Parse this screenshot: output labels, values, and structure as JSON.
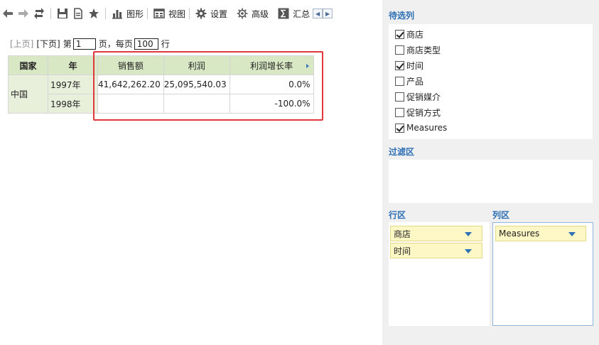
{
  "toolbar": {
    "buttons": [
      {
        "name": "back",
        "icon": "arrow-left-icon"
      },
      {
        "name": "forward",
        "icon": "arrow-right-icon"
      },
      {
        "name": "refresh",
        "icon": "refresh-icon"
      },
      {
        "name": "save",
        "icon": "save-icon"
      },
      {
        "name": "export",
        "icon": "document-icon"
      },
      {
        "name": "favorite",
        "icon": "star-icon"
      }
    ],
    "chart_label": "图形",
    "view_label": "视图",
    "settings_label": "设置",
    "advanced_label": "高级",
    "summary_label": "汇总"
  },
  "pager": {
    "prev": "[上页]",
    "next": "[下页]",
    "page_prefix": "第",
    "page_value": "1",
    "page_suffix": "页，每页",
    "rows_value": "100",
    "rows_suffix": "行"
  },
  "pivot": {
    "row_headers": [
      "国家",
      "年"
    ],
    "col_headers": [
      "销售额",
      "利润",
      "利润增长率"
    ],
    "country": "中国",
    "rows": [
      {
        "year": "1997年",
        "sales": "41,642,262.20",
        "profit": "25,095,540.03",
        "growth": "0.0%"
      },
      {
        "year": "1998年",
        "sales": "",
        "profit": "",
        "growth": "-100.0%"
      }
    ]
  },
  "panel": {
    "candidates_title": "待选列",
    "fields": [
      {
        "label": "商店",
        "checked": true
      },
      {
        "label": "商店类型",
        "checked": false
      },
      {
        "label": "时间",
        "checked": true
      },
      {
        "label": "产品",
        "checked": false
      },
      {
        "label": "促销媒介",
        "checked": false
      },
      {
        "label": "促销方式",
        "checked": false
      },
      {
        "label": "Measures",
        "checked": true
      }
    ],
    "filter_title": "过滤区",
    "row_title": "行区",
    "row_items": [
      "商店",
      "时间"
    ],
    "col_title": "列区",
    "col_items": [
      "Measures"
    ]
  },
  "colors": {
    "accent": "#2d6fb5",
    "header_green": "#d9e8c4",
    "highlight_red": "#e0383e",
    "chip_yellow": "#fdf7c5"
  }
}
